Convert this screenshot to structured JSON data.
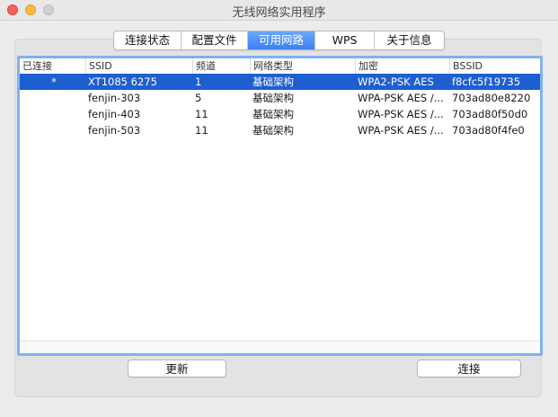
{
  "window": {
    "title": "无线网络实用程序"
  },
  "tabs": [
    {
      "label": "连接状态",
      "active": false
    },
    {
      "label": "配置文件",
      "active": false
    },
    {
      "label": "可用网路",
      "active": true
    },
    {
      "label": "WPS",
      "active": false
    },
    {
      "label": "关于信息",
      "active": false
    }
  ],
  "table": {
    "columns": [
      "已连接",
      "SSID",
      "频道",
      "网络类型",
      "加密",
      "BSSID"
    ],
    "rows": [
      {
        "connected": "*",
        "ssid": "XT1085 6275",
        "channel": "1",
        "type": "基础架构",
        "encryption": "WPA2-PSK AES",
        "bssid": "f8cfc5f19735",
        "selected": true
      },
      {
        "connected": "",
        "ssid": "fenjin-303",
        "channel": "5",
        "type": "基础架构",
        "encryption": "WPA-PSK AES /...",
        "bssid": "703ad80e8220",
        "selected": false
      },
      {
        "connected": "",
        "ssid": "fenjin-403",
        "channel": "11",
        "type": "基础架构",
        "encryption": "WPA-PSK AES /...",
        "bssid": "703ad80f50d0",
        "selected": false
      },
      {
        "connected": "",
        "ssid": "fenjin-503",
        "channel": "11",
        "type": "基础架构",
        "encryption": "WPA-PSK AES /...",
        "bssid": "703ad80f4fe0",
        "selected": false
      }
    ]
  },
  "buttons": {
    "refresh": "更新",
    "connect": "连接"
  },
  "colors": {
    "accent": "#1d5fd1",
    "focus_ring": "#7fb1f3"
  }
}
